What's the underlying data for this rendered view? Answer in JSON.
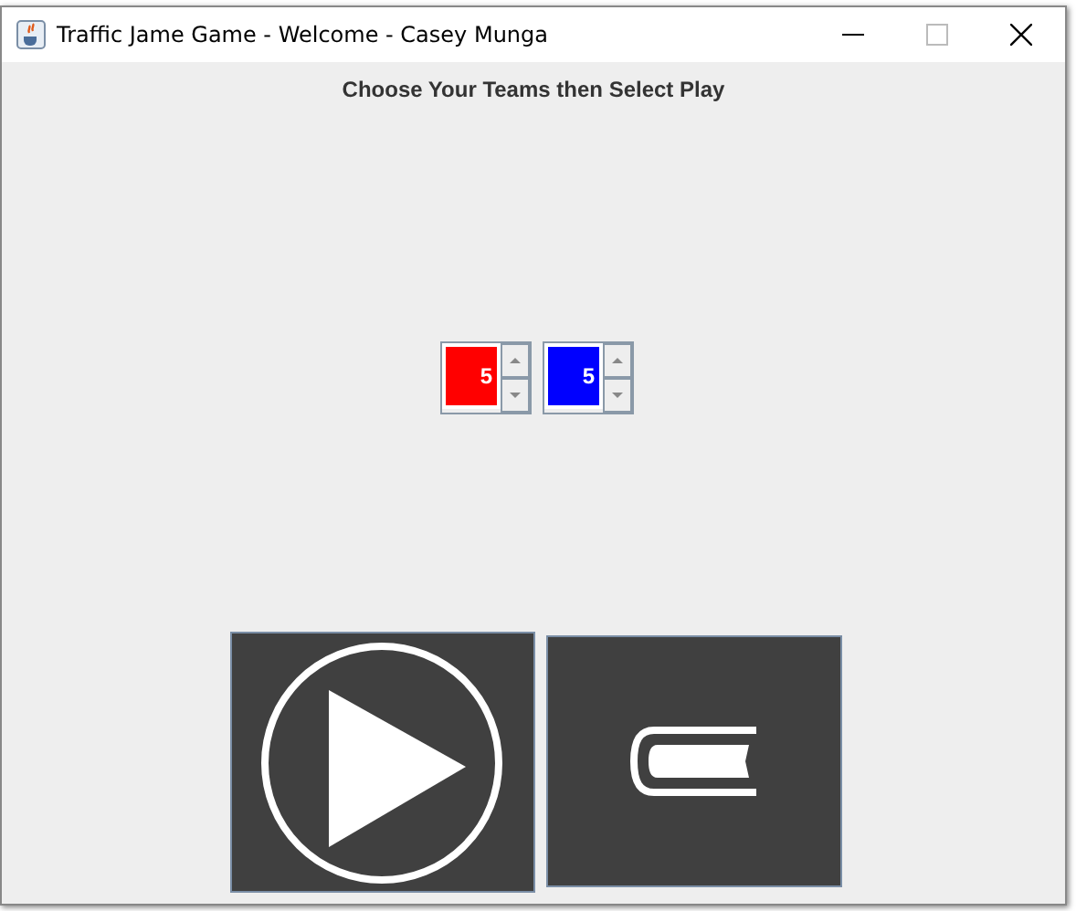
{
  "window": {
    "title": "Traffic Jame Game - Welcome - Casey Munga"
  },
  "heading": "Choose Your Teams then Select Play",
  "teams": [
    {
      "value": "5",
      "color": "#ff0000"
    },
    {
      "value": "5",
      "color": "#0000ff"
    }
  ],
  "buttons": [
    {
      "kind": "play"
    },
    {
      "kind": "book"
    }
  ]
}
